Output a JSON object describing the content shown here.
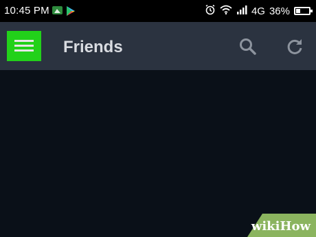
{
  "status_bar": {
    "time": "10:45 PM",
    "network": "4G",
    "battery_percent": "36%",
    "battery_level": 0.36,
    "icons": [
      "notification-icon",
      "play-store-icon",
      "alarm-icon",
      "wifi-icon",
      "signal-icon",
      "battery-icon"
    ]
  },
  "app_bar": {
    "title": "Friends",
    "menu_highlight_color": "#22d11a",
    "background_color": "#2b3340",
    "icons": [
      "hamburger-menu-icon",
      "search-icon",
      "refresh-icon"
    ]
  },
  "watermark": {
    "text": "wikiHow",
    "color": "#8bb45f"
  }
}
